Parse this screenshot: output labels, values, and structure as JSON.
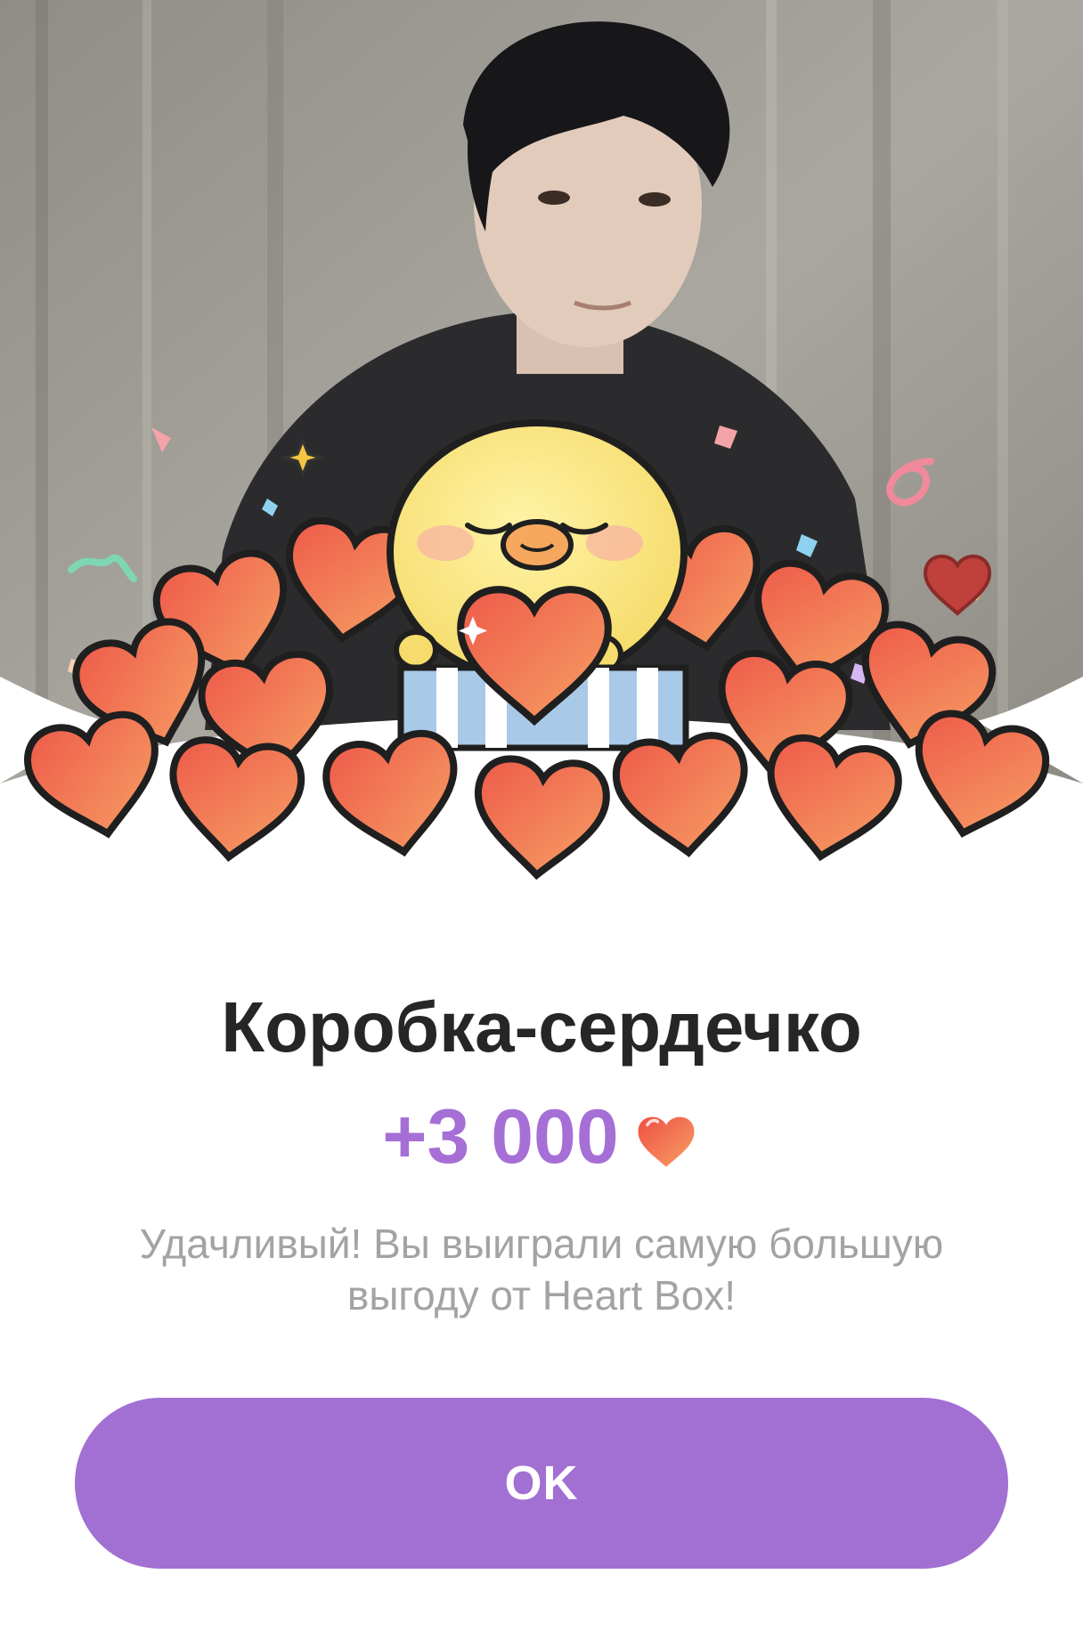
{
  "reward": {
    "title": "Коробка-сердечко",
    "amount": "+3 000",
    "currency_icon": "heart-icon",
    "message": "Удачливый! Вы выиграли самую большую выгоду от Heart Box!"
  },
  "actions": {
    "ok_label": "OK"
  },
  "colors": {
    "accent": "#a26fd3",
    "amount_text": "#a56fd6",
    "title_text": "#262626",
    "message_text": "#a3a3a3",
    "heart": "#ef6b4f"
  },
  "illustration": {
    "character": "yellow-chick-mascot",
    "items": [
      "hearts",
      "gift-box",
      "confetti"
    ]
  }
}
